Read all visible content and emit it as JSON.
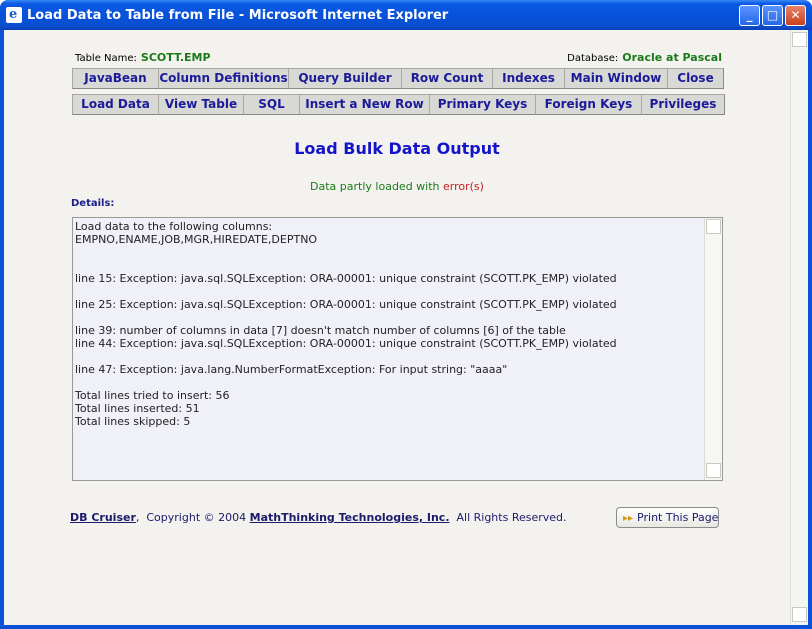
{
  "window": {
    "title": "Load Data to Table from File - Microsoft Internet Explorer",
    "icon": "ie-page-icon",
    "controls": {
      "minimize": "_",
      "maximize": "□",
      "close": "✕"
    }
  },
  "meta": {
    "table_label": "Table Name:",
    "table_value": "SCOTT.EMP",
    "database_label": "Database:",
    "database_value": "Oracle at Pascal"
  },
  "nav_row1": [
    "JavaBean",
    "Column Definitions",
    "Query Builder",
    "Row Count",
    "Indexes",
    "Main Window",
    "Close"
  ],
  "nav_row2": [
    "Load Data",
    "View Table",
    "SQL",
    "Insert a New Row",
    "Primary Keys",
    "Foreign Keys",
    "Privileges"
  ],
  "heading": "Load Bulk Data Output",
  "status": {
    "text": "Data partly loaded with",
    "error_text": "error(s)"
  },
  "details_label": "Details:",
  "output_lines": [
    "Load data to the following columns:",
    "EMPNO,ENAME,JOB,MGR,HIREDATE,DEPTNO",
    "",
    "",
    "line 15: Exception: java.sql.SQLException: ORA-00001: unique constraint (SCOTT.PK_EMP) violated",
    "",
    "line 25: Exception: java.sql.SQLException: ORA-00001: unique constraint (SCOTT.PK_EMP) violated",
    "",
    "line 39: number of columns in data [7] doesn't match number of columns [6] of the table",
    "line 44: Exception: java.sql.SQLException: ORA-00001: unique constraint (SCOTT.PK_EMP) violated",
    "",
    "line 47: Exception: java.lang.NumberFormatException: For input string: \"aaaa\"",
    "",
    "Total lines tried to insert: 56",
    "Total lines inserted: 51",
    "Total lines skipped: 5"
  ],
  "footer": {
    "app_link": "DB Cruiser",
    "copyright": ",  Copyright © 2004 ",
    "company_link": "MathThinking Technologies, Inc.",
    "rights": "  All Rights Reserved."
  },
  "print_button": {
    "label": "Print This Page",
    "icon": "forward-arrows-icon"
  }
}
